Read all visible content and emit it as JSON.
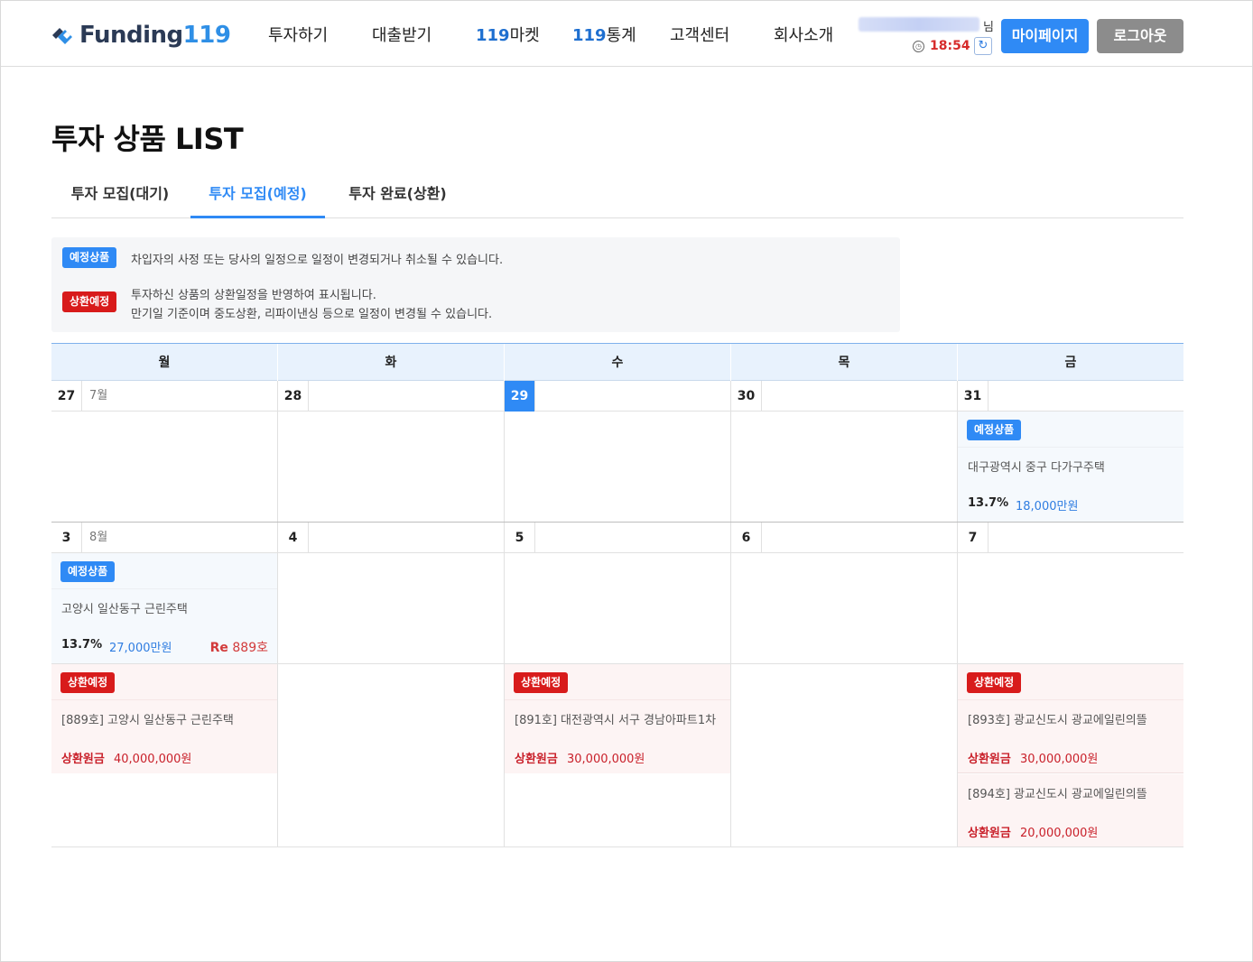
{
  "header": {
    "logo_word": "Funding",
    "logo_num": "119",
    "nav": [
      {
        "label": "투자하기",
        "prefix": ""
      },
      {
        "label": "대출받기",
        "prefix": ""
      },
      {
        "label": "마켓",
        "prefix": "119"
      },
      {
        "label": "통계",
        "prefix": "119"
      },
      {
        "label": "고객센터",
        "prefix": ""
      },
      {
        "label": "회사소개",
        "prefix": ""
      }
    ],
    "user_suffix": "님",
    "timer": "18:54",
    "mypage_label": "마이페이지",
    "logout_label": "로그아웃"
  },
  "page_title": "투자 상품 LIST",
  "tabs": [
    "투자 모집(대기)",
    "투자 모집(예정)",
    "투자 완료(상환)"
  ],
  "notice": {
    "plan_badge": "예정상품",
    "plan_text": "차입자의 사정 또는 당사의 일정으로 일정이 변경되거나 취소될 수 있습니다.",
    "repay_badge": "상환예정",
    "repay_text_1": "투자하신 상품의 상환일정을 반영하여 표시됩니다.",
    "repay_text_2": "만기일 기준이며 중도상환, 리파이낸싱 등으로 일정이 변경될 수 있습니다."
  },
  "calendar": {
    "days": [
      "월",
      "화",
      "수",
      "목",
      "금"
    ],
    "week1": {
      "dates": [
        "27",
        "28",
        "29",
        "30",
        "31"
      ],
      "month_label": "7월",
      "fri_card": {
        "badge": "예정상품",
        "addr": "대구광역시 중구 다가구주택",
        "rate": "13.7%",
        "amount": "18,000만원"
      }
    },
    "week2": {
      "dates": [
        "3",
        "4",
        "5",
        "6",
        "7"
      ],
      "month_label": "8월",
      "mon_plan": {
        "badge": "예정상품",
        "addr": "고양시 일산동구 근린주택",
        "rate": "13.7%",
        "amount": "27,000만원",
        "re_prefix": "Re",
        "re_no": "889호"
      },
      "mon_repay": {
        "badge": "상환예정",
        "addr": "[889호] 고양시 일산동구 근린주택",
        "principal_label": "상환원금",
        "principal": "40,000,000원"
      },
      "wed_repay": {
        "badge": "상환예정",
        "addr": "[891호] 대전광역시 서구 경남아파트1차",
        "principal_label": "상환원금",
        "principal": "30,000,000원"
      },
      "fri_repay1": {
        "badge": "상환예정",
        "addr": "[893호] 광교신도시 광교에일린의뜰",
        "principal_label": "상환원금",
        "principal": "30,000,000원"
      },
      "fri_repay2": {
        "addr": "[894호] 광교신도시 광교에일린의뜰",
        "principal_label": "상환원금",
        "principal": "20,000,000원"
      }
    }
  },
  "colors": {
    "accent": "#2f8af5",
    "danger": "#d81b1b",
    "logout": "#8c8c8c"
  }
}
